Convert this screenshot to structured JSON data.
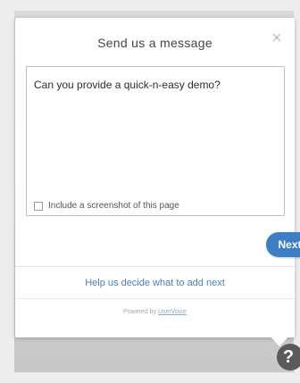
{
  "dialog": {
    "title": "Send us a message",
    "close_icon": "close-icon",
    "message_text": "Can you provide a quick-n-easy demo?",
    "screenshot_label": "Include a screenshot of this page",
    "screenshot_checked": false,
    "next_label": "Next",
    "help_link": "Help us decide what to add next",
    "powered_prefix": "Powered by",
    "powered_brand": "UserVoice"
  },
  "launcher": {
    "icon": "question-mark-icon",
    "glyph": "?"
  },
  "colors": {
    "accent": "#3d7fc6",
    "link": "#4b7eb8",
    "launcher": "#5a5a5a"
  }
}
